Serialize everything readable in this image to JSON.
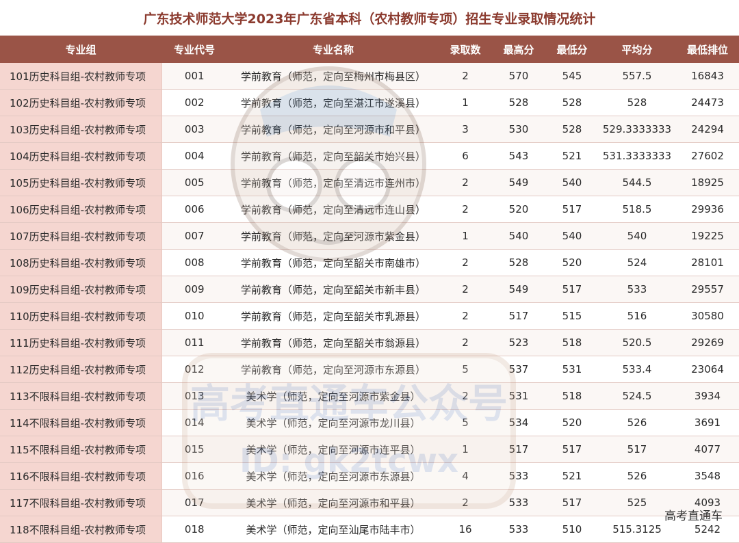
{
  "title": "广东技术师范大学2023年广东省本科（农村教师专项）招生专业录取情况统计",
  "headers": [
    "专业组",
    "专业代号",
    "专业名称",
    "录取数",
    "最高分",
    "最低分",
    "平均分",
    "最低排位"
  ],
  "rows": [
    {
      "group": "101历史科目组-农村教师专项",
      "code": "001",
      "name": "学前教育（师范，定向至梅州市梅县区）",
      "count": "2",
      "max": "570",
      "min": "545",
      "avg": "557.5",
      "rank": "16843"
    },
    {
      "group": "102历史科目组-农村教师专项",
      "code": "002",
      "name": "学前教育（师范，定向至湛江市遂溪县）",
      "count": "1",
      "max": "528",
      "min": "528",
      "avg": "528",
      "rank": "24473"
    },
    {
      "group": "103历史科目组-农村教师专项",
      "code": "003",
      "name": "学前教育（师范，定向至河源市和平县）",
      "count": "3",
      "max": "530",
      "min": "528",
      "avg": "529.3333333",
      "rank": "24294"
    },
    {
      "group": "104历史科目组-农村教师专项",
      "code": "004",
      "name": "学前教育（师范，定向至韶关市始兴县）",
      "count": "6",
      "max": "543",
      "min": "521",
      "avg": "531.3333333",
      "rank": "27602"
    },
    {
      "group": "105历史科目组-农村教师专项",
      "code": "005",
      "name": "学前教育（师范，定向至清远市连州市）",
      "count": "2",
      "max": "549",
      "min": "540",
      "avg": "544.5",
      "rank": "18925"
    },
    {
      "group": "106历史科目组-农村教师专项",
      "code": "006",
      "name": "学前教育（师范，定向至清远市连山县）",
      "count": "2",
      "max": "520",
      "min": "517",
      "avg": "518.5",
      "rank": "29936"
    },
    {
      "group": "107历史科目组-农村教师专项",
      "code": "007",
      "name": "学前教育（师范，定向至河源市紫金县）",
      "count": "1",
      "max": "540",
      "min": "540",
      "avg": "540",
      "rank": "19225"
    },
    {
      "group": "108历史科目组-农村教师专项",
      "code": "008",
      "name": "学前教育（师范，定向至韶关市南雄市）",
      "count": "2",
      "max": "528",
      "min": "520",
      "avg": "524",
      "rank": "28101"
    },
    {
      "group": "109历史科目组-农村教师专项",
      "code": "009",
      "name": "学前教育（师范，定向至韶关市新丰县）",
      "count": "2",
      "max": "549",
      "min": "517",
      "avg": "533",
      "rank": "29557"
    },
    {
      "group": "110历史科目组-农村教师专项",
      "code": "010",
      "name": "学前教育（师范，定向至韶关市乳源县）",
      "count": "2",
      "max": "517",
      "min": "515",
      "avg": "516",
      "rank": "30580"
    },
    {
      "group": "111历史科目组-农村教师专项",
      "code": "011",
      "name": "学前教育（师范，定向至韶关市翁源县）",
      "count": "2",
      "max": "523",
      "min": "518",
      "avg": "520.5",
      "rank": "29269"
    },
    {
      "group": "112历史科目组-农村教师专项",
      "code": "012",
      "name": "学前教育（师范，定向至河源市东源县）",
      "count": "5",
      "max": "537",
      "min": "531",
      "avg": "533.4",
      "rank": "23064"
    },
    {
      "group": "113不限科目组-农村教师专项",
      "code": "013",
      "name": "美术学（师范，定向至河源市紫金县）",
      "count": "2",
      "max": "531",
      "min": "518",
      "avg": "524.5",
      "rank": "3934"
    },
    {
      "group": "114不限科目组-农村教师专项",
      "code": "014",
      "name": "美术学（师范，定向至河源市龙川县）",
      "count": "5",
      "max": "534",
      "min": "520",
      "avg": "526",
      "rank": "3691"
    },
    {
      "group": "115不限科目组-农村教师专项",
      "code": "015",
      "name": "美术学（师范，定向至河源市连平县）",
      "count": "1",
      "max": "517",
      "min": "517",
      "avg": "517",
      "rank": "4077"
    },
    {
      "group": "116不限科目组-农村教师专项",
      "code": "016",
      "name": "美术学（师范，定向至河源市东源县）",
      "count": "4",
      "max": "533",
      "min": "521",
      "avg": "526",
      "rank": "3548"
    },
    {
      "group": "117不限科目组-农村教师专项",
      "code": "017",
      "name": "美术学（师范，定向至河源市和平县）",
      "count": "2",
      "max": "533",
      "min": "517",
      "avg": "525",
      "rank": "4093"
    },
    {
      "group": "118不限科目组-农村教师专项",
      "code": "018",
      "name": "美术学（师范，定向至汕尾市陆丰市）",
      "count": "16",
      "max": "533",
      "min": "510",
      "avg": "515.3125",
      "rank": "5242"
    }
  ],
  "watermark": {
    "line1": "高考直通车公众号",
    "line2": "ID: gk2tcwx"
  },
  "corner_mark": "高考直通车",
  "colors": {
    "title": "#8b3a2e",
    "header_bg": "#9a5447",
    "group_bg": "#f5d6d0"
  }
}
